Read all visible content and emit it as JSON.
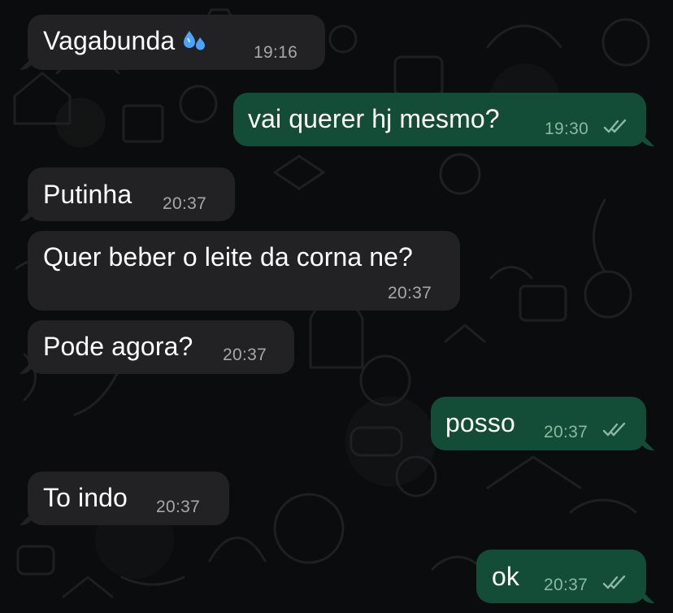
{
  "messages": [
    {
      "direction": "incoming",
      "text": "Vagabunda",
      "emoji": "sweat-droplets-icon",
      "time": "19:16"
    },
    {
      "direction": "outgoing",
      "text": "vai querer hj mesmo?",
      "time": "19:30",
      "status": "read"
    },
    {
      "direction": "incoming",
      "text": "Putinha",
      "time": "20:37"
    },
    {
      "direction": "incoming",
      "text": "Quer beber o leite da corna ne?",
      "time": "20:37"
    },
    {
      "direction": "incoming",
      "text": "Pode agora?",
      "time": "20:37"
    },
    {
      "direction": "outgoing",
      "text": "posso",
      "time": "20:37",
      "status": "read"
    },
    {
      "direction": "incoming",
      "text": "To indo",
      "time": "20:37"
    },
    {
      "direction": "outgoing",
      "text": "ok",
      "time": "20:37",
      "status": "read"
    }
  ],
  "colors": {
    "background": "#0b0c0d",
    "incoming_bubble": "#222224",
    "outgoing_bubble": "#134d37",
    "text": "#ffffff",
    "incoming_timestamp": "#a7a7a7",
    "outgoing_timestamp": "#8ab8a0",
    "emoji": "#4aa3ff"
  }
}
